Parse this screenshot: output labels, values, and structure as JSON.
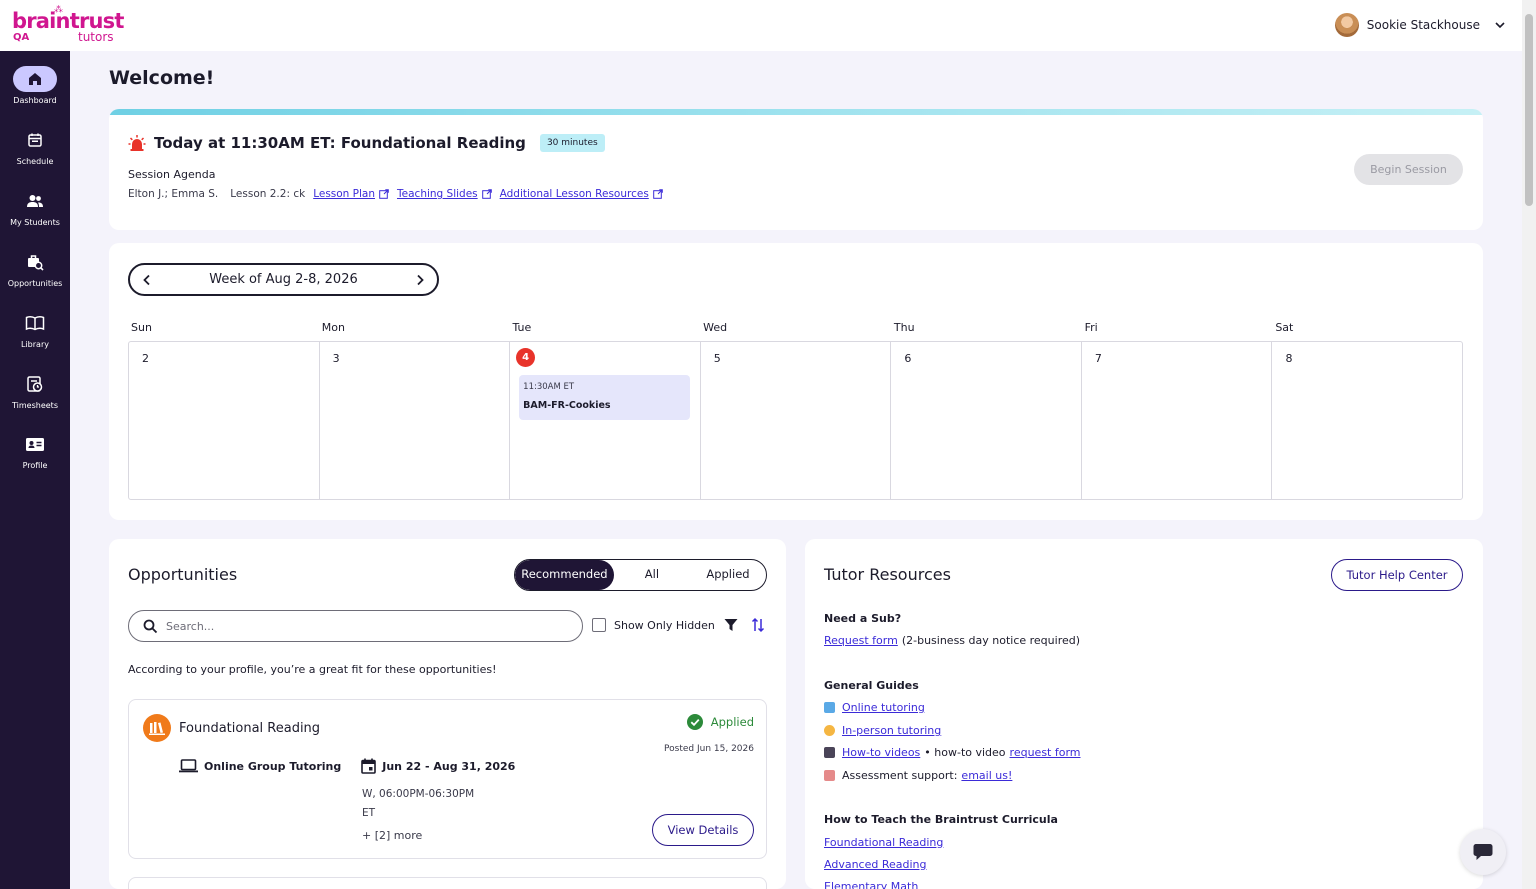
{
  "header": {
    "logo_brand": "braintrust",
    "logo_env": "QA",
    "logo_sub": "tutors",
    "user_name": "Sookie Stackhouse"
  },
  "sidebar": {
    "items": [
      {
        "label": "Dashboard",
        "icon": "home-icon",
        "active": true
      },
      {
        "label": "Schedule",
        "icon": "calendar-icon"
      },
      {
        "label": "My Students",
        "icon": "users-icon"
      },
      {
        "label": "Opportunities",
        "icon": "briefcase-search-icon"
      },
      {
        "label": "Library",
        "icon": "book-icon"
      },
      {
        "label": "Timesheets",
        "icon": "timesheet-icon"
      },
      {
        "label": "Profile",
        "icon": "id-card-icon"
      }
    ]
  },
  "page": {
    "title": "Welcome!"
  },
  "session": {
    "title": "Today at 11:30AM ET: Foundational Reading",
    "duration_badge": "30 minutes",
    "agenda_label": "Session Agenda",
    "students": "Elton J.; Emma S.",
    "lesson": "Lesson 2.2: ck",
    "links": [
      "Lesson Plan",
      "Teaching Slides",
      "Additional Lesson Resources"
    ],
    "begin_button": "Begin Session"
  },
  "calendar": {
    "week_label": "Week of Aug 2-8, 2026",
    "days": [
      {
        "dow": "Sun",
        "num": "2"
      },
      {
        "dow": "Mon",
        "num": "3"
      },
      {
        "dow": "Tue",
        "num": "4",
        "today": true
      },
      {
        "dow": "Wed",
        "num": "5"
      },
      {
        "dow": "Thu",
        "num": "6"
      },
      {
        "dow": "Fri",
        "num": "7"
      },
      {
        "dow": "Sat",
        "num": "8"
      }
    ],
    "event": {
      "time": "11:30AM ET",
      "name": "BAM-FR-Cookies"
    }
  },
  "opportunities": {
    "title": "Opportunities",
    "tabs": [
      "Recommended",
      "All",
      "Applied"
    ],
    "search_placeholder": "Search...",
    "show_hidden_label": "Show Only Hidden",
    "intro": "According to your profile, you’re a great fit for these opportunities!",
    "item": {
      "name": "Foundational Reading",
      "status": "Applied",
      "posted": "Posted Jun 15, 2026",
      "format": "Online Group Tutoring",
      "dates": "Jun 22 - Aug 31, 2026",
      "schedule_line1": "W, 06:00PM-06:30PM",
      "schedule_line2": "ET",
      "more": "+ [2] more",
      "view_button": "View Details"
    }
  },
  "resources": {
    "title": "Tutor Resources",
    "help_button": "Tutor Help Center",
    "sub_heading": "Need a Sub?",
    "sub_link": "Request form",
    "sub_note": "(2-business day notice required)",
    "guides_heading": "General Guides",
    "online_link": "Online tutoring",
    "inperson_link": " In-person tutoring",
    "howto_link": "How-to videos",
    "howto_mid": "• how-to video",
    "howto_request_link": "request form",
    "assessment_text": "Assessment support:",
    "assessment_link": "email us!",
    "curricula_heading": "How to Teach the Braintrust Curricula",
    "curricula_links": [
      "Foundational Reading",
      "Advanced Reading",
      "Elementary Math"
    ]
  },
  "colors": {
    "sidebar_bg": "#1f1535",
    "brand": "#d0168f",
    "link": "#3b2bd8",
    "today_red": "#e8332a",
    "applied_green": "#2c8a3a"
  }
}
